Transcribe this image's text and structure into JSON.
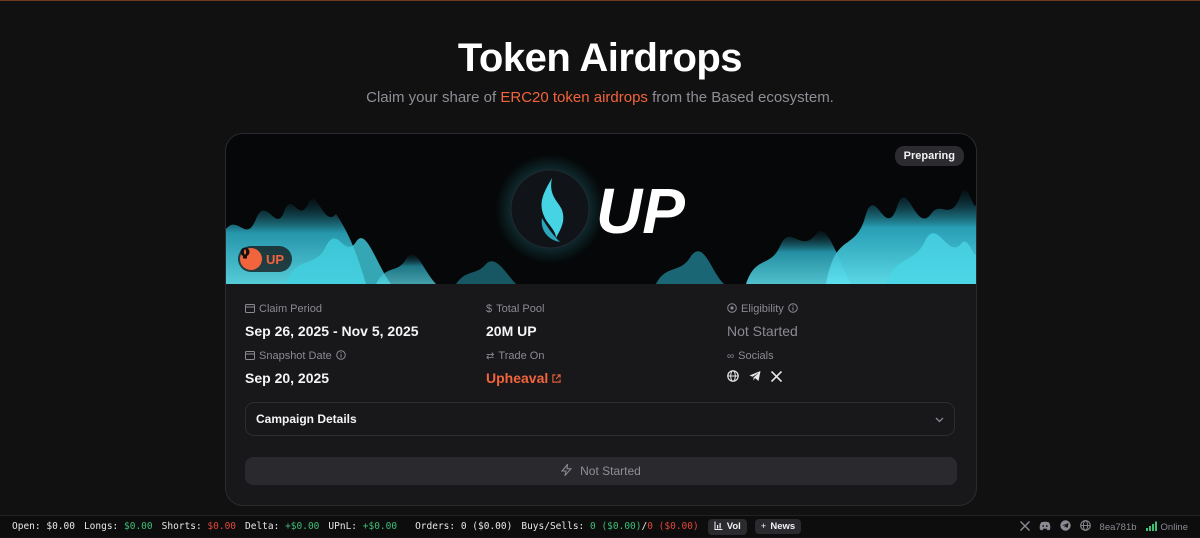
{
  "hero": {
    "title": "Token Airdrops",
    "subtitle_pre": "Claim your share of",
    "subtitle_highlight": "ERC20 token airdrops",
    "subtitle_post": "from the Based ecosystem."
  },
  "card": {
    "status_badge": "Preparing",
    "banner_text": "UP",
    "token_symbol": "UP",
    "fields": {
      "claim_period_label": "Claim Period",
      "claim_period_value": "Sep 26, 2025 - Nov 5, 2025",
      "total_pool_label": "Total Pool",
      "total_pool_value": "20M UP",
      "eligibility_label": "Eligibility",
      "eligibility_value": "Not Started",
      "snapshot_label": "Snapshot Date",
      "snapshot_value": "Sep 20, 2025",
      "trade_on_label": "Trade On",
      "trade_on_value": "Upheaval",
      "socials_label": "Socials"
    },
    "socials": [
      "globe-icon",
      "telegram-icon",
      "x-icon"
    ],
    "details_label": "Campaign Details",
    "claim_button_label": "Not Started"
  },
  "statusbar": {
    "open_label": "Open:",
    "open_value": "$0.00",
    "longs_label": "Longs:",
    "longs_value": "$0.00",
    "shorts_label": "Shorts:",
    "shorts_value": "$0.00",
    "delta_label": "Delta:",
    "delta_value": "+$0.00",
    "upnl_label": "UPnL:",
    "upnl_value": "+$0.00",
    "orders_label": "Orders:",
    "orders_value": "0 ($0.00)",
    "buys_sells_label": "Buys/Sells:",
    "buys_value": "0 ($0.00)",
    "sep": "/",
    "sells_value": "0 ($0.00)",
    "vol_label": "Vol",
    "news_label": "News",
    "build_hash": "8ea781b",
    "connection_status": "Online"
  },
  "colors": {
    "accent": "#f2643c",
    "positive": "#3fbf78",
    "negative": "#e0463c",
    "flame": "#38c9dc"
  }
}
